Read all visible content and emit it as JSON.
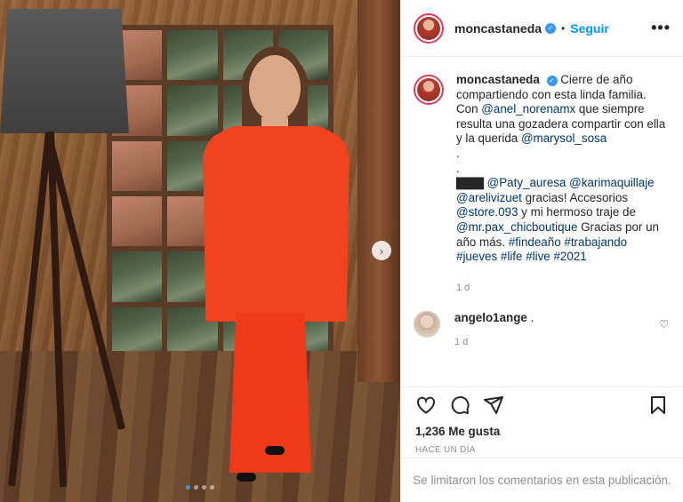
{
  "post": {
    "username": "moncastaneda",
    "follow_label": "Seguir",
    "more_label": "•••",
    "caption_text_1": "Cierre de año compartiendo con esta linda familia. Con ",
    "mention_1": "@anel_norenamx",
    "caption_text_2": " que siempre resulta una gozadera compartir con ella y la querida ",
    "mention_2": "@marysol_sosa",
    "dot_1": ".",
    "dot_2": ".",
    "emojis": "▇▇▇",
    "mention_3": "@Paty_auresa",
    "mention_4": "@karimaquillaje",
    "mention_5": "@arelivizuet",
    "caption_text_3": " gracias! Accesorios ",
    "mention_6": "@store.093",
    "caption_text_4": " y mi hermoso traje de ",
    "mention_7": "@mr.pax_chicboutique",
    "caption_text_5": " Gracias por un año más.",
    "hashtags": [
      "#findeaño",
      "#trabajando",
      "#jueves",
      "#life",
      "#live",
      "#2021"
    ],
    "caption_time": "1 d",
    "comment": {
      "username": "angelo1ange",
      "text": ".",
      "time": "1 d"
    },
    "likes": "1,236 Me gusta",
    "date": "HACE UN DÍA",
    "footer_notice": "Se limitaron los comentarios en esta publicación."
  },
  "carousel": {
    "count": 4,
    "active": 0
  },
  "colors": {
    "accent": "#0095f6",
    "verified": "#3897f0",
    "link": "#00376b",
    "muted": "#8e8e8e"
  },
  "icons": [
    "heart-icon",
    "comment-icon",
    "share-icon",
    "bookmark-icon",
    "more-icon",
    "verified-icon",
    "chevron-right-icon"
  ]
}
